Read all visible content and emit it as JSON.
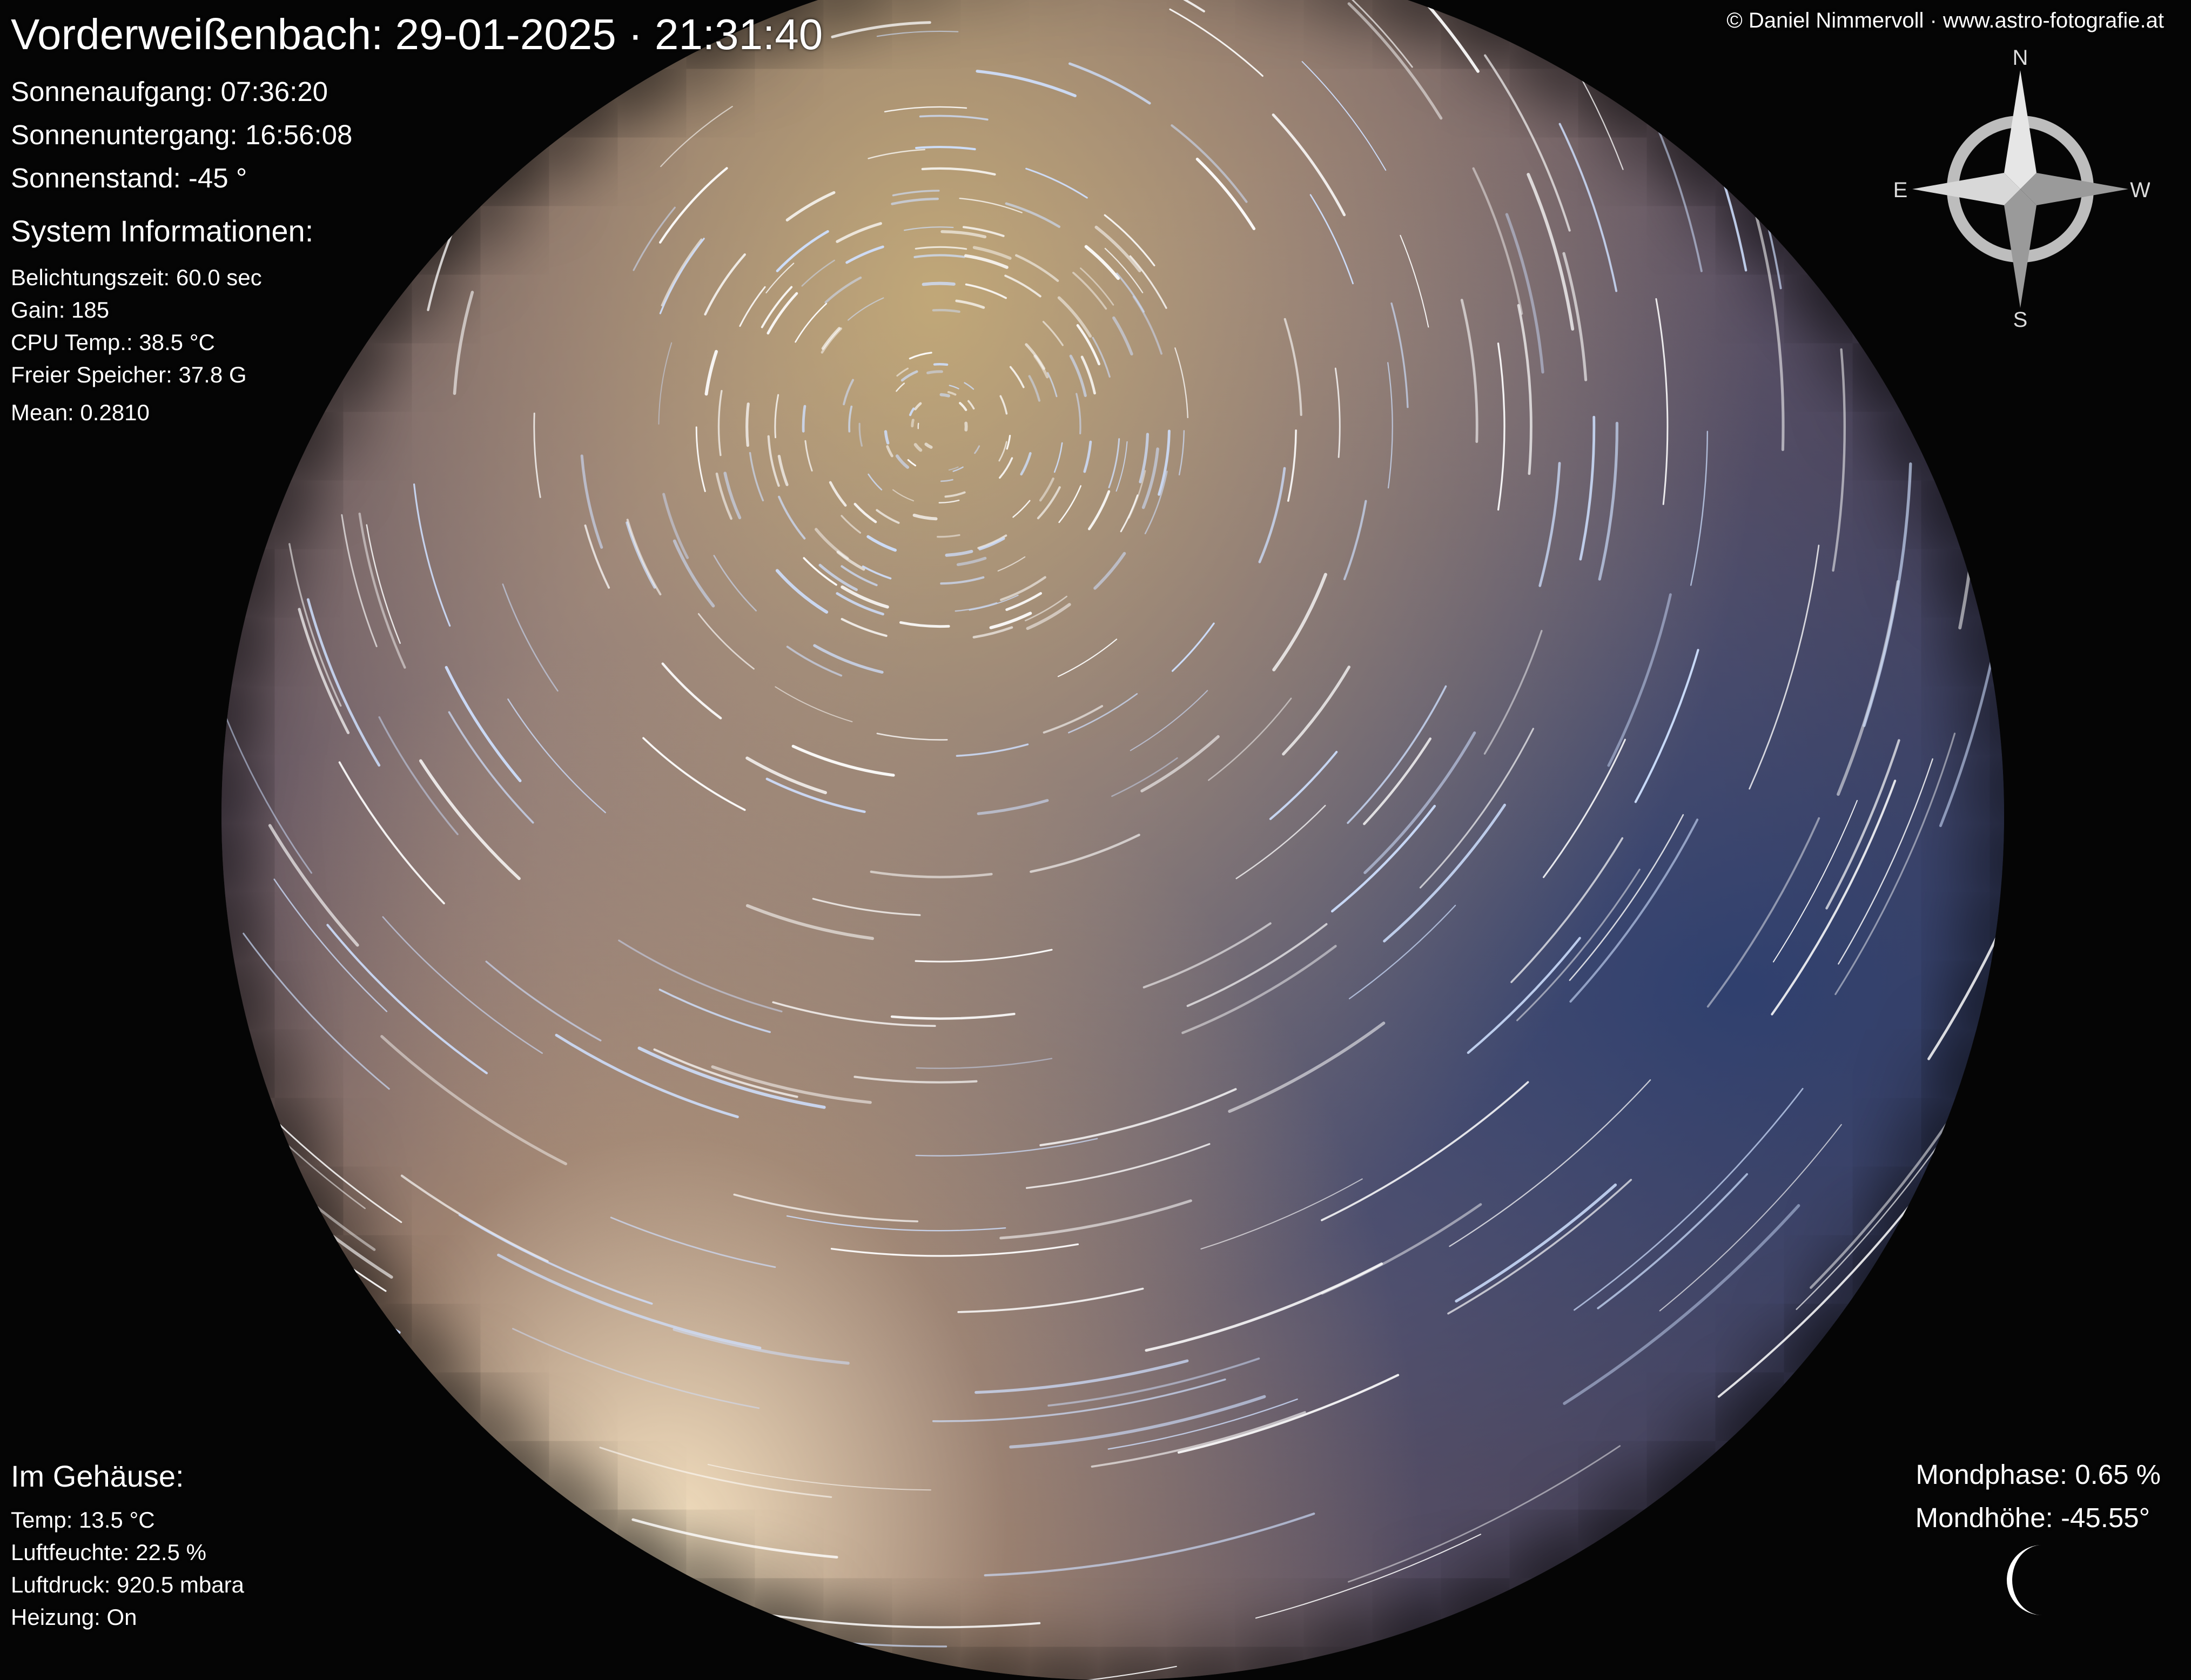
{
  "header": {
    "title": "Vorderweißenbach: 29-01-2025 · 21:31:40",
    "credit": "© Daniel Nimmervoll · www.astro-fotografie.at"
  },
  "sun": {
    "sunrise": "Sonnenaufgang: 07:36:20",
    "sunset": "Sonnenuntergang: 16:56:08",
    "position": "Sonnenstand: -45 °"
  },
  "system": {
    "heading": "System Informationen:",
    "exposure": "Belichtungszeit: 60.0 sec",
    "gain": "Gain: 185",
    "cpu_temp": "CPU Temp.: 38.5 °C",
    "free_storage": "Freier Speicher: 37.8 G",
    "mean": "Mean: 0.2810"
  },
  "enclosure": {
    "heading": "Im Gehäuse:",
    "temp": "Temp: 13.5 °C",
    "humidity": "Luftfeuchte: 22.5 %",
    "pressure": "Luftdruck: 920.5 mbara",
    "heating": "Heizung: On"
  },
  "moon": {
    "phase": "Mondphase: 0.65 %",
    "altitude": "Mondhöhe: -45.55°",
    "icon": "crescent-moon-icon"
  },
  "compass": {
    "north": "N",
    "south": "S",
    "east": "E",
    "west": "W",
    "icon": "compass-rose-icon"
  },
  "colors": {
    "text": "#ffffff",
    "background": "#050505",
    "compass": "#bdbdbd"
  }
}
